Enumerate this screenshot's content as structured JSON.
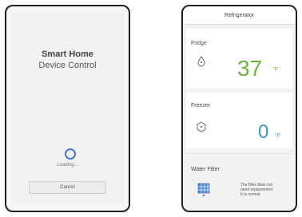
{
  "left": {
    "title": "Smart Home",
    "subtitle": "Device Control",
    "loading_text": "Loading...",
    "cancel_label": "Cancel"
  },
  "right": {
    "header_title": "Refrigerator",
    "fridge": {
      "label": "Fridge",
      "temp": "37",
      "unit": "°F",
      "color": "#6cb33e"
    },
    "freezer": {
      "label": "Freezer",
      "temp": "0",
      "unit": "°F",
      "color": "#3a97d3"
    },
    "water_filter": {
      "label": "Water Filter",
      "message_line1": "The filter does not",
      "message_line2": "need replacement",
      "message_line3": "It is normal"
    }
  },
  "icons": {
    "spinner": "loading-spinner-icon",
    "fridge": "drop-icon",
    "freezer": "freezer-icon",
    "filter": "filter-icon"
  }
}
